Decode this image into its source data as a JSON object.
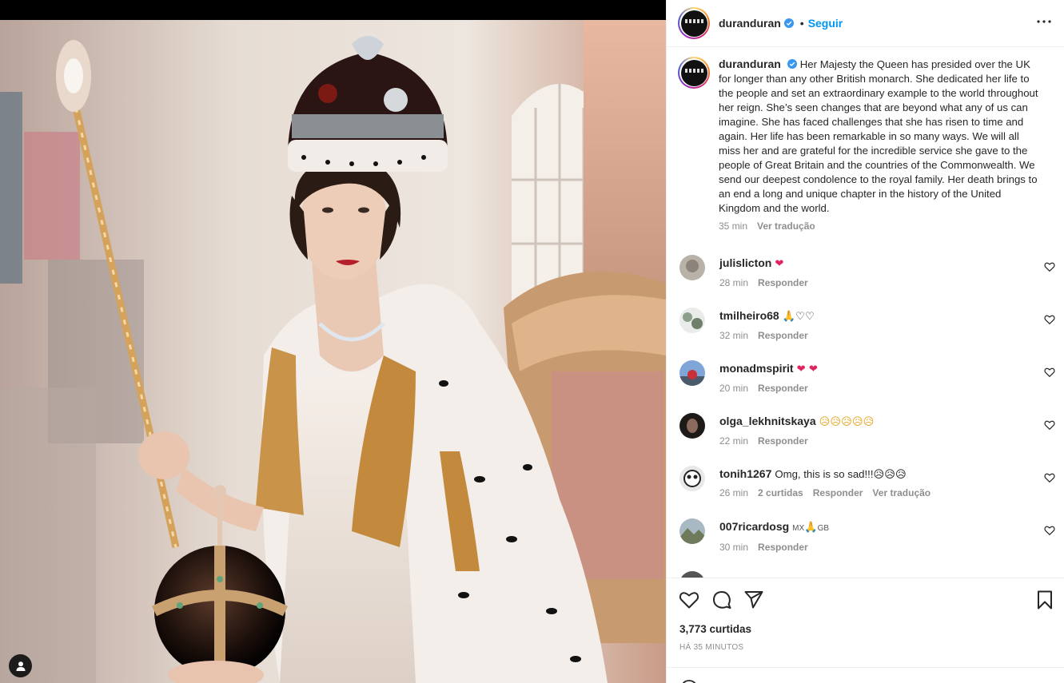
{
  "colors": {
    "accent": "#0095f6",
    "text": "#262626",
    "muted": "#8e8e8e",
    "heart": "#e0245e",
    "border": "#efefef"
  },
  "media": {
    "alt_icon": "user-tag-icon",
    "tag_button_icon": "person-icon"
  },
  "header": {
    "username": "duranduran",
    "verified_icon": "verified-badge-icon",
    "separator": "•",
    "follow_label": "Seguir",
    "more_icon": "more-options-icon"
  },
  "caption": {
    "username": "duranduran",
    "text": "Her Majesty the Queen has presided over the UK for longer than any other British monarch. She dedicated her life to the people and set an extraordinary example to the world throughout her reign. She’s seen changes that are beyond what any of us can imagine. She has faced challenges that she has risen to time and again. Her life has been remarkable in so many ways. We will all miss her and are grateful for the incredible service she gave to the people of Great Britain and the countries of the Commonwealth. We send our deepest condolence to the royal family. Her death brings to an end a long and unique chapter in the history of the United Kingdom and the world.",
    "time": "35 min",
    "translate_label": "Ver tradução"
  },
  "comments": [
    {
      "username": "julislicton",
      "text": "❤",
      "time": "28 min",
      "reply": "Responder"
    },
    {
      "username": "tmilheiro68",
      "text": "🙏♡♡",
      "time": "32 min",
      "reply": "Responder"
    },
    {
      "username": "monadmspirit",
      "text": "❤ ❤",
      "time": "20 min",
      "reply": "Responder"
    },
    {
      "username": "olga_lekhnitskaya",
      "text": "😥😥😥😥😥",
      "time": "22 min",
      "reply": "Responder"
    },
    {
      "username": "tonih1267",
      "text": "Omg, this is so sad!!!😥😥😥",
      "time": "26 min",
      "likes": "2 curtidas",
      "reply": "Responder",
      "translate": "Ver tradução"
    },
    {
      "username": "007ricardosg",
      "text_pre": "MX",
      "text_emoji": "🙏",
      "text_post": "GB",
      "time": "30 min",
      "reply": "Responder"
    }
  ],
  "actions": {
    "like_icon": "heart-outline-icon",
    "comment_icon": "comment-icon",
    "share_icon": "share-icon",
    "save_icon": "bookmark-icon",
    "likes_count": "3,773 curtidas",
    "posted": "HÁ 35 MINUTOS"
  }
}
